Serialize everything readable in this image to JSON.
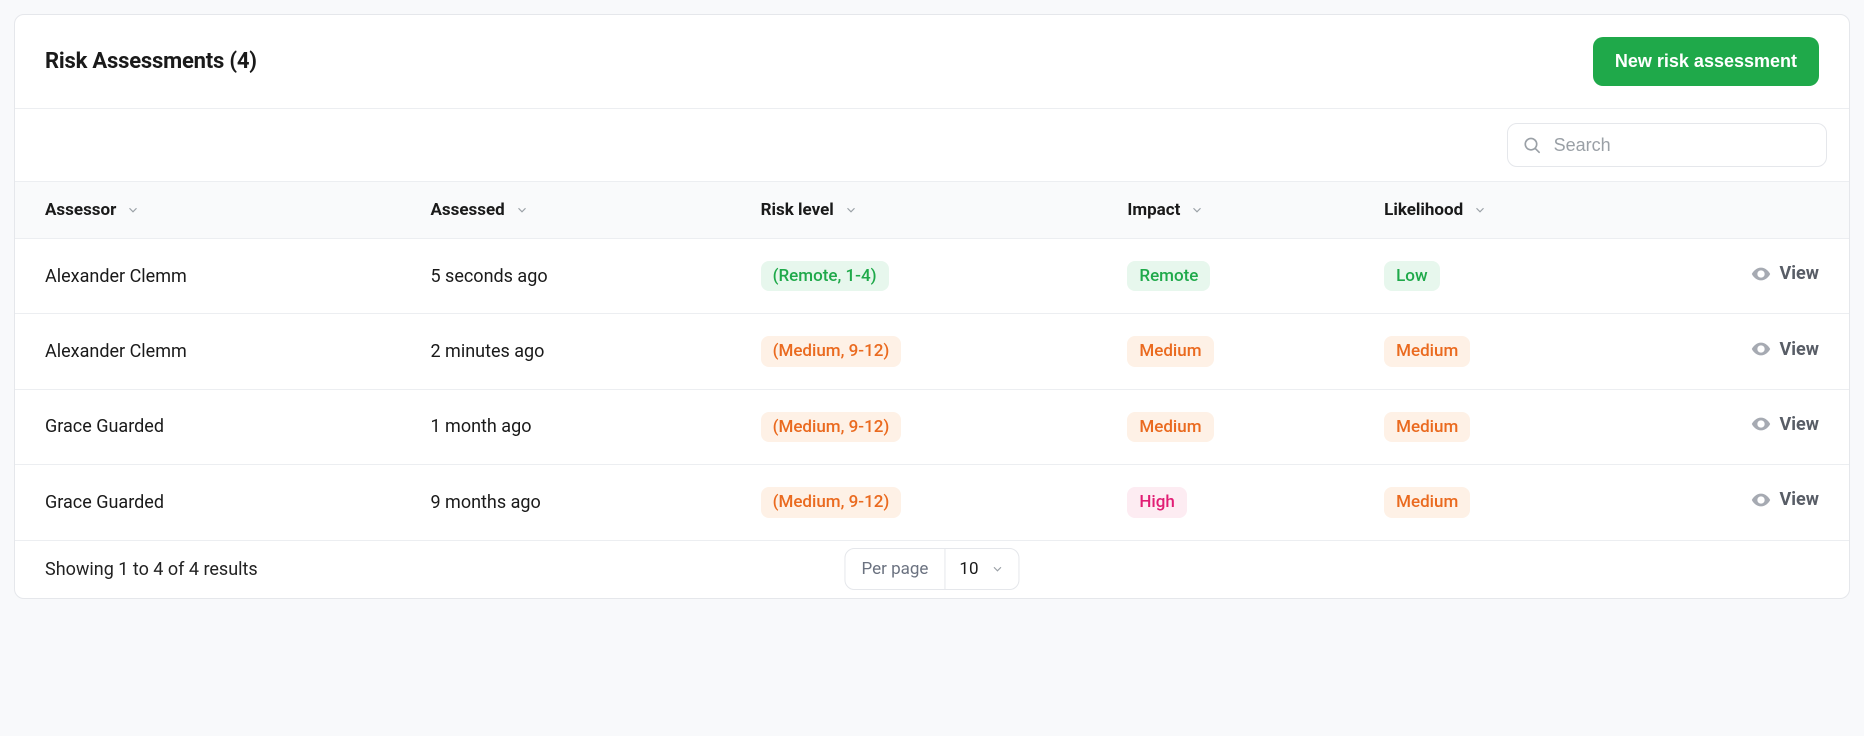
{
  "header": {
    "title": "Risk Assessments (4)",
    "primary_button": "New risk assessment"
  },
  "search": {
    "placeholder": "Search"
  },
  "columns": {
    "assessor": "Assessor",
    "assessed": "Assessed",
    "risk_level": "Risk level",
    "impact": "Impact",
    "likelihood": "Likelihood"
  },
  "rows": [
    {
      "assessor": "Alexander Clemm",
      "assessed": "5 seconds ago",
      "risk_level": {
        "text": "(Remote, 1-4)",
        "color": "green"
      },
      "impact": {
        "text": "Remote",
        "color": "green"
      },
      "likelihood": {
        "text": "Low",
        "color": "green"
      }
    },
    {
      "assessor": "Alexander Clemm",
      "assessed": "2 minutes ago",
      "risk_level": {
        "text": "(Medium, 9-12)",
        "color": "orange"
      },
      "impact": {
        "text": "Medium",
        "color": "orange"
      },
      "likelihood": {
        "text": "Medium",
        "color": "orange"
      }
    },
    {
      "assessor": "Grace Guarded",
      "assessed": "1 month ago",
      "risk_level": {
        "text": "(Medium, 9-12)",
        "color": "orange"
      },
      "impact": {
        "text": "Medium",
        "color": "orange"
      },
      "likelihood": {
        "text": "Medium",
        "color": "orange"
      }
    },
    {
      "assessor": "Grace Guarded",
      "assessed": "9 months ago",
      "risk_level": {
        "text": "(Medium, 9-12)",
        "color": "orange"
      },
      "impact": {
        "text": "High",
        "color": "pink"
      },
      "likelihood": {
        "text": "Medium",
        "color": "orange"
      }
    }
  ],
  "footer": {
    "results_text": "Showing 1 to 4 of 4 results",
    "per_page_label": "Per page",
    "per_page_value": "10"
  },
  "labels": {
    "view": "View"
  }
}
